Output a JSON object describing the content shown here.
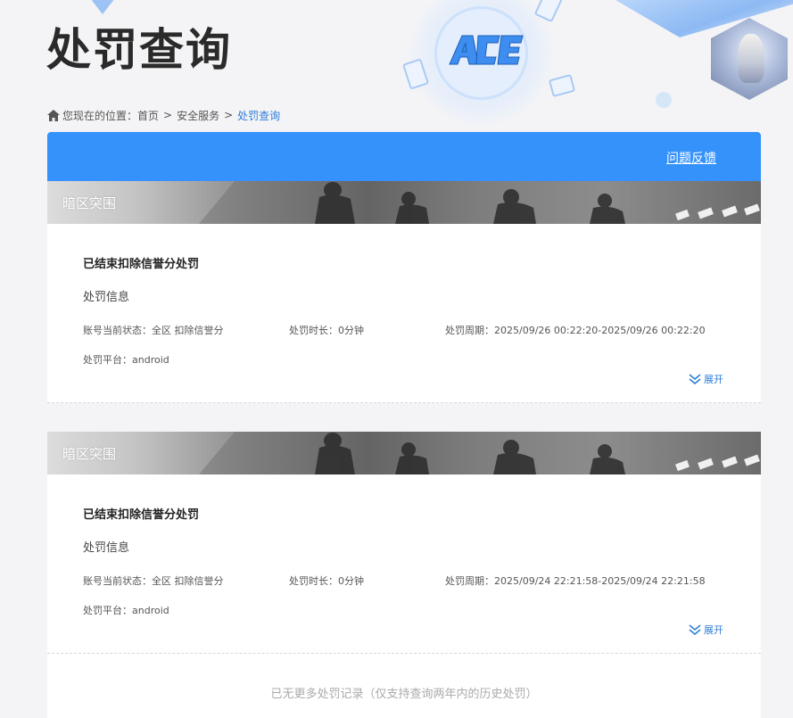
{
  "header": {
    "title": "处罚查询"
  },
  "breadcrumb": {
    "prefix": "您现在的位置：",
    "items": [
      "首页",
      "安全服务",
      "处罚查询"
    ],
    "separator": ">"
  },
  "toolbar": {
    "feedback_label": "问题反馈"
  },
  "records": [
    {
      "game": "暗区突围",
      "status": "已结束扣除信誉分处罚",
      "info_title": "处罚信息",
      "account_status": "账号当前状态：全区 扣除信誉分",
      "duration": "处罚时长：0分钟",
      "period": "处罚周期：2025/09/26 00:22:20-2025/09/26 00:22:20",
      "platform": "处罚平台：android",
      "expand_label": "展开"
    },
    {
      "game": "暗区突围",
      "status": "已结束扣除信誉分处罚",
      "info_title": "处罚信息",
      "account_status": "账号当前状态：全区 扣除信誉分",
      "duration": "处罚时长：0分钟",
      "period": "处罚周期：2025/09/24 22:21:58-2025/09/24 22:21:58",
      "platform": "处罚平台：android",
      "expand_label": "展开"
    }
  ],
  "footer": {
    "note": "已无更多处罚记录（仅支持查询两年内的历史处罚）"
  },
  "colors": {
    "accent": "#3592fb",
    "link": "#2e7ed6",
    "title": "#2a2a2a"
  },
  "icons": {
    "breadcrumb": "home-icon",
    "expand": "double-chevron-down-icon",
    "logo": "ace-logo"
  }
}
